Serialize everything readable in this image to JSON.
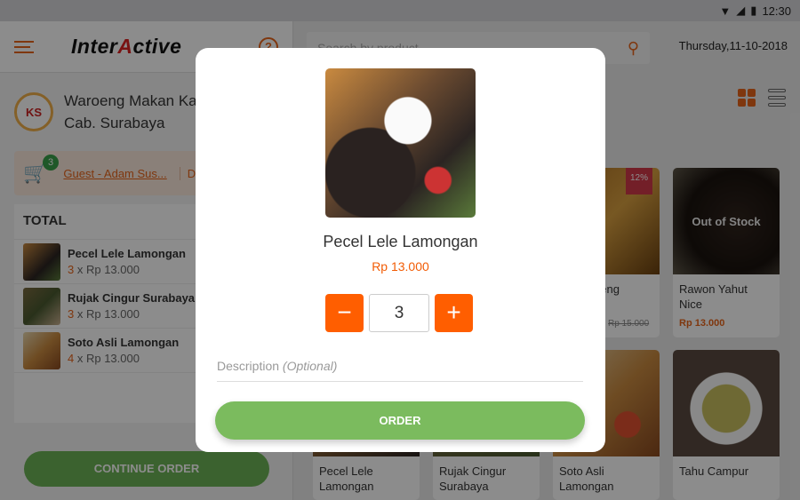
{
  "status": {
    "time": "12:30"
  },
  "header": {
    "logo": "InterActive",
    "help_icon": "question-circle-icon",
    "search_placeholder": "Search by product",
    "date": "Thursday,11-10-2018"
  },
  "store": {
    "name": "Waroeng Makan Kampoeng",
    "branch": "Cab. Surabaya"
  },
  "cart": {
    "count": "3",
    "guest": "Guest - Adam Sus...",
    "dine": "Dine In"
  },
  "order_list": {
    "title": "TOTAL",
    "items": [
      {
        "name": "Pecel Lele Lamongan",
        "qty": "3",
        "price": "x Rp 13.000"
      },
      {
        "name": "Rujak Cingur Surabaya",
        "qty": "3",
        "price": "x Rp 13.000"
      },
      {
        "name": "Soto Asli Lamongan",
        "qty": "4",
        "price": "x Rp 13.000"
      }
    ]
  },
  "continue_label": "CONTINUE ORDER",
  "products": [
    {
      "name": "Mie Goreng",
      "old_price": "Rp 15.000",
      "discount": "12%"
    },
    {
      "name": "Rawon Yahut Nice",
      "price": "Rp 13.000",
      "status": "Out of Stock"
    },
    {
      "name": "Pecel Lele Lamongan"
    },
    {
      "name": "Rujak Cingur Surabaya"
    },
    {
      "name": "Soto Asli Lamongan"
    },
    {
      "name": "Tahu Campur"
    }
  ],
  "modal": {
    "title": "Pecel Lele Lamongan",
    "price": "Rp 13.000",
    "quantity": "3",
    "minus": "−",
    "plus": "+",
    "description_label": "Description",
    "description_hint": "(Optional)",
    "order_label": "ORDER"
  },
  "colors": {
    "accent": "#ff5e00",
    "primary_green": "#7bbb5e"
  }
}
